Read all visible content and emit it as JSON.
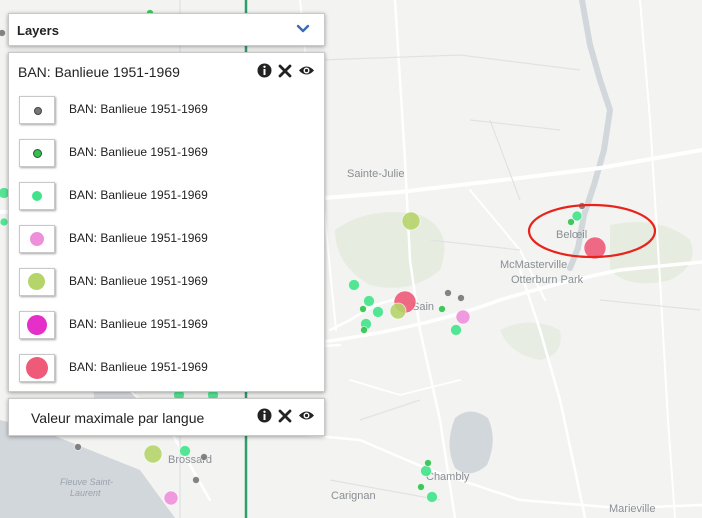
{
  "map": {
    "places": [
      {
        "name": "Sainte-Julie",
        "cls": ""
      },
      {
        "name": "Belœil",
        "cls": ""
      },
      {
        "name": "McMasterville",
        "cls": ""
      },
      {
        "name": "Otterburn Park",
        "cls": ""
      },
      {
        "name": "Sain",
        "cls": ""
      },
      {
        "name": "Brossard",
        "cls": ""
      },
      {
        "name": "Chambly",
        "cls": ""
      },
      {
        "name": "Carignan",
        "cls": ""
      },
      {
        "name": "Marieville",
        "cls": ""
      },
      {
        "name": "Fleuve Saint-",
        "cls": "italic"
      },
      {
        "name": "Laurent",
        "cls": "italic"
      }
    ],
    "markers": [
      {
        "color": "#ef5a78",
        "size": "large"
      },
      {
        "color": "#ef5a78",
        "size": "large"
      },
      {
        "color": "#b5d46a",
        "size": "medium"
      },
      {
        "color": "#b5d46a",
        "size": "medium"
      },
      {
        "color": "#b5d46a",
        "size": "medium"
      },
      {
        "color": "#ee8fdc",
        "size": "small-medium"
      },
      {
        "color": "#ee8fdc",
        "size": "small-medium"
      },
      {
        "color": "#41e38a",
        "size": "small"
      },
      {
        "color": "#41e38a",
        "size": "small"
      },
      {
        "color": "#41e38a",
        "size": "small"
      },
      {
        "color": "#41e38a",
        "size": "small"
      },
      {
        "color": "#41e38a",
        "size": "small"
      },
      {
        "color": "#41e38a",
        "size": "small"
      },
      {
        "color": "#41e38a",
        "size": "small"
      },
      {
        "color": "#41e38a",
        "size": "small"
      },
      {
        "color": "#41e38a",
        "size": "small"
      },
      {
        "color": "#41e38a",
        "size": "small"
      },
      {
        "color": "#41e38a",
        "size": "small"
      },
      {
        "color": "#41e38a",
        "size": "small"
      },
      {
        "color": "#41e38a",
        "size": "small"
      },
      {
        "color": "#2ec24b",
        "size": "tiny"
      },
      {
        "color": "#2ec24b",
        "size": "tiny"
      },
      {
        "color": "#2ec24b",
        "size": "tiny"
      },
      {
        "color": "#2ec24b",
        "size": "tiny"
      },
      {
        "color": "#2ec24b",
        "size": "tiny"
      },
      {
        "color": "#2ec24b",
        "size": "tiny"
      },
      {
        "color": "#2ec24b",
        "size": "tiny"
      },
      {
        "color": "#777777",
        "size": "tiny"
      },
      {
        "color": "#777777",
        "size": "tiny"
      },
      {
        "color": "#777777",
        "size": "tiny"
      },
      {
        "color": "#777777",
        "size": "tiny"
      },
      {
        "color": "#777777",
        "size": "tiny"
      },
      {
        "color": "#777777",
        "size": "tiny"
      },
      {
        "color": "#777777",
        "size": "tiny"
      }
    ],
    "annotation_color": "#e8231c"
  },
  "layers_header": {
    "title": "Layers",
    "icon": "chevron-down-icon"
  },
  "legend": {
    "title": "BAN: Banlieue 1951-1969",
    "controls": [
      "info-icon",
      "close-icon",
      "eye-icon"
    ],
    "items": [
      {
        "label": "BAN: Banlieue 1951-1969",
        "color": "#777777"
      },
      {
        "label": "BAN: Banlieue 1951-1969",
        "color": "#2ec24b"
      },
      {
        "label": "BAN: Banlieue 1951-1969",
        "color": "#41e38a"
      },
      {
        "label": "BAN: Banlieue 1951-1969",
        "color": "#ee8fdc"
      },
      {
        "label": "BAN: Banlieue 1951-1969",
        "color": "#b5d46a"
      },
      {
        "label": "BAN: Banlieue 1951-1969",
        "color": "#e62ec8"
      },
      {
        "label": "BAN: Banlieue 1951-1969",
        "color": "#ef5a78"
      }
    ]
  },
  "valeur": {
    "title": "Valeur maximale par langue"
  }
}
